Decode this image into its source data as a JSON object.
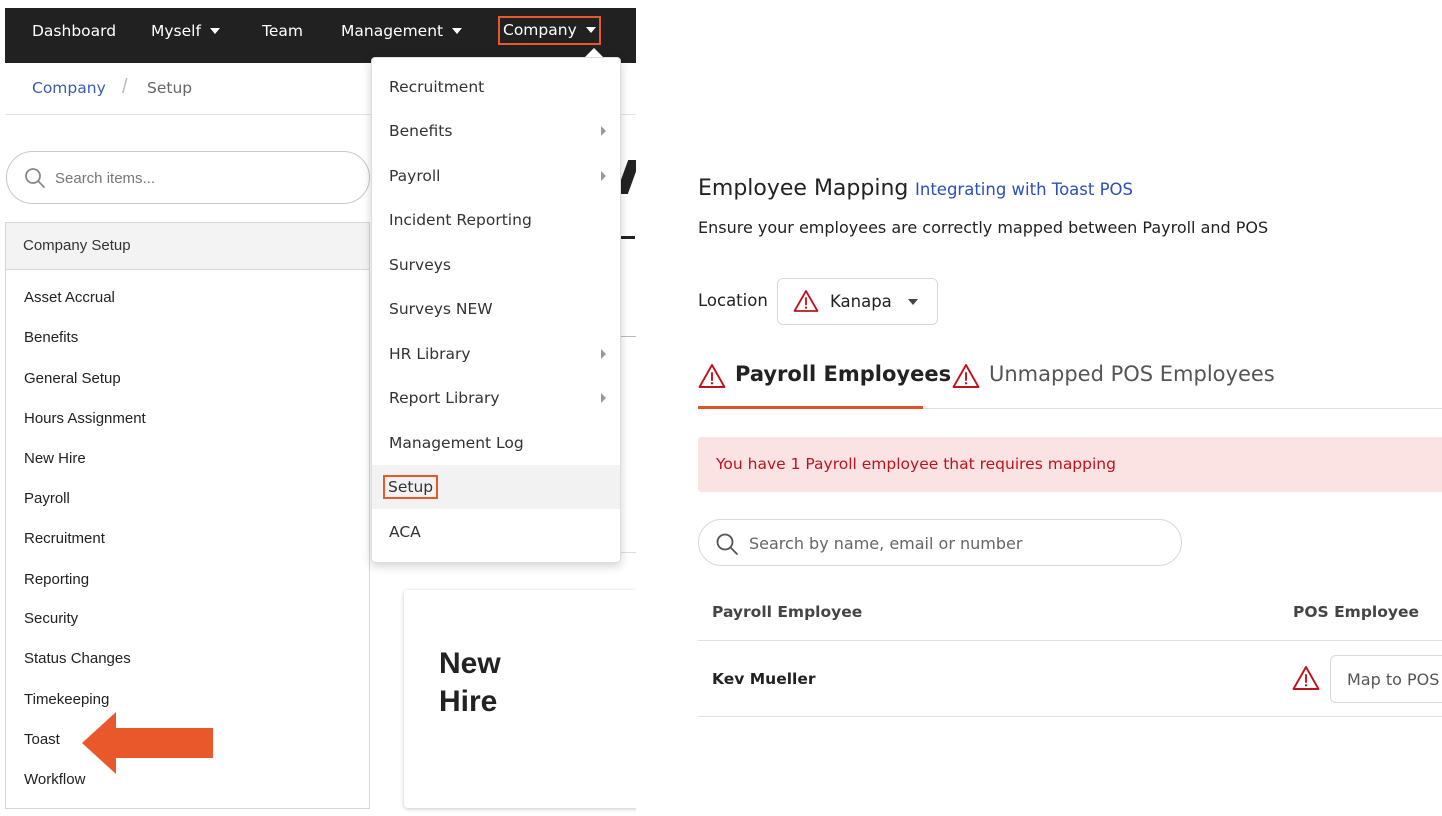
{
  "nav": {
    "dashboard": "Dashboard",
    "myself": "Myself",
    "team": "Team",
    "management": "Management",
    "company": "Company"
  },
  "breadcrumb": {
    "company": "Company",
    "separator": "/",
    "current": "Setup"
  },
  "sidebar": {
    "search_placeholder": "Search items...",
    "header": "Company Setup",
    "items": [
      {
        "label": "Asset Accrual"
      },
      {
        "label": "Benefits"
      },
      {
        "label": "General Setup"
      },
      {
        "label": "Hours Assignment"
      },
      {
        "label": "New Hire"
      },
      {
        "label": "Payroll"
      },
      {
        "label": "Recruitment"
      },
      {
        "label": "Reporting"
      },
      {
        "label": "Security"
      },
      {
        "label": "Status Changes"
      },
      {
        "label": "Timekeeping"
      },
      {
        "label": "Toast"
      },
      {
        "label": "Workflow"
      }
    ]
  },
  "card": {
    "title": "New Hire"
  },
  "dropdown": {
    "items": [
      {
        "label": "Recruitment",
        "submenu": false
      },
      {
        "label": "Benefits",
        "submenu": true
      },
      {
        "label": "Payroll",
        "submenu": true
      },
      {
        "label": "Incident Reporting",
        "submenu": false
      },
      {
        "label": "Surveys",
        "submenu": false
      },
      {
        "label": "Surveys NEW",
        "submenu": false
      },
      {
        "label": "HR Library",
        "submenu": true
      },
      {
        "label": "Report Library",
        "submenu": true
      },
      {
        "label": "Management Log",
        "submenu": false
      },
      {
        "label": "Setup",
        "submenu": false,
        "active": true
      },
      {
        "label": "ACA",
        "submenu": false
      }
    ]
  },
  "mapping": {
    "title": "Employee Mapping",
    "link": "Integrating with Toast POS",
    "subtitle": "Ensure your employees are correctly mapped between Payroll and POS",
    "location_label": "Location",
    "location_value": "Kanapa",
    "tabs": [
      {
        "label": "Payroll Employees",
        "active": true
      },
      {
        "label": "Unmapped POS Employees",
        "active": false
      }
    ],
    "alert": "You have 1 Payroll employee that requires mapping",
    "search_placeholder": "Search by name, email or number",
    "columns": {
      "payroll": "Payroll Employee",
      "pos": "POS Employee"
    },
    "rows": [
      {
        "name": "Kev Mueller",
        "action": "Map to POS Employee"
      }
    ]
  },
  "colors": {
    "accent_orange": "#e8582b",
    "warning_red": "#c0121c",
    "link_blue": "#2a4fb8",
    "nav_bg": "#212121"
  }
}
